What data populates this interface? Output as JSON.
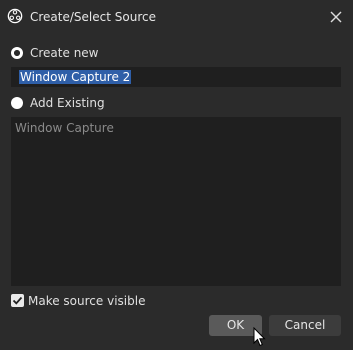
{
  "window": {
    "title": "Create/Select Source",
    "app_icon": "obs-logo-icon",
    "close_icon": "close-icon"
  },
  "create_new": {
    "label": "Create new",
    "selected": true,
    "name_value": "Window Capture 2"
  },
  "add_existing": {
    "label": "Add Existing",
    "selected": false,
    "items": [
      "Window Capture"
    ]
  },
  "make_visible": {
    "label": "Make source visible",
    "checked": true
  },
  "buttons": {
    "ok": "OK",
    "cancel": "Cancel"
  },
  "colors": {
    "background": "#2b2b2b",
    "field": "#1f1f1f",
    "selection": "#2f5fa8",
    "ok_button": "#5a5a5a",
    "cancel_button": "#3c3c3c"
  }
}
